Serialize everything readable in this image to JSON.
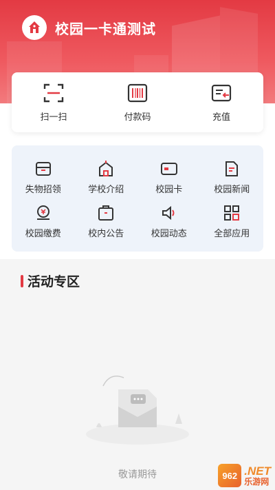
{
  "header": {
    "title": "校园一卡通测试",
    "logo_icon": "school-building-icon"
  },
  "quick_actions": [
    {
      "label": "扫一扫",
      "icon": "scan-icon"
    },
    {
      "label": "付款码",
      "icon": "barcode-icon"
    },
    {
      "label": "充值",
      "icon": "recharge-icon"
    }
  ],
  "services": [
    {
      "label": "失物招领",
      "icon": "lost-found-icon"
    },
    {
      "label": "学校介绍",
      "icon": "school-icon"
    },
    {
      "label": "校园卡",
      "icon": "card-icon"
    },
    {
      "label": "校园新闻",
      "icon": "news-icon"
    },
    {
      "label": "校园缴费",
      "icon": "payment-icon"
    },
    {
      "label": "校内公告",
      "icon": "notice-icon"
    },
    {
      "label": "校园动态",
      "icon": "speaker-icon"
    },
    {
      "label": "全部应用",
      "icon": "all-apps-icon"
    }
  ],
  "activity": {
    "section_title": "活动专区",
    "empty_text": "敬请期待"
  },
  "watermark": {
    "badge": "962",
    "top": ".NET",
    "bottom": "乐游网"
  },
  "colors": {
    "brand_red": "#e33a43",
    "icon_dark": "#333333"
  }
}
